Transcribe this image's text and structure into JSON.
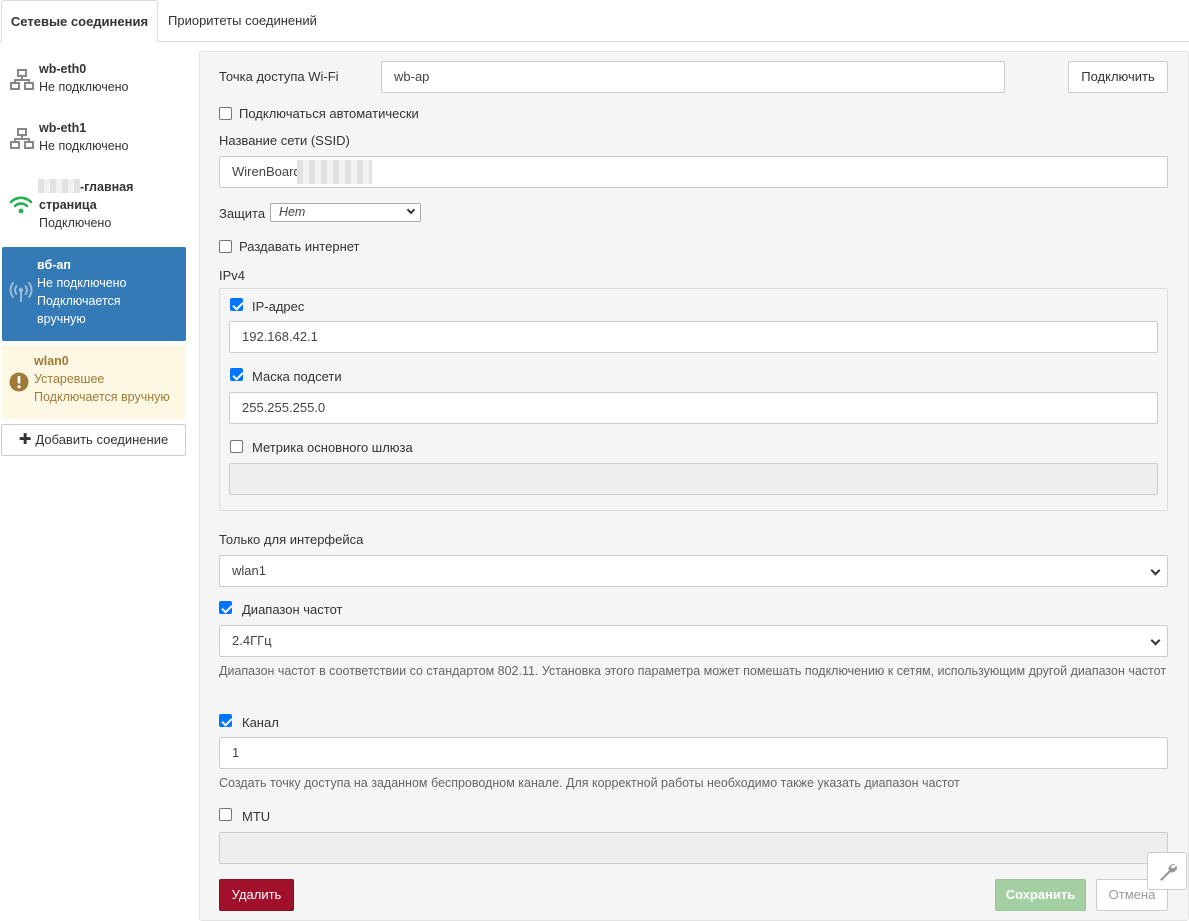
{
  "tabs": [
    "Сетевые соединения",
    "Приоритеты соединений"
  ],
  "connections": [
    {
      "name": "wb-eth0",
      "status": "Не подключено",
      "icon": "ethernet-icon"
    },
    {
      "name": "wb-eth1",
      "status": "Не подключено",
      "icon": "ethernet-icon"
    },
    {
      "name": "-главная",
      "name2": "страница",
      "status": "Подключено",
      "icon": "wifi-icon"
    },
    {
      "name": "вб-ап",
      "status": "Не подключено",
      "status2": "Подключается",
      "status3": "вручную",
      "icon": "access-point-icon"
    },
    {
      "name": "wlan0",
      "status": "Устаревшее",
      "status2": "Подключается вручную",
      "icon": "warning-icon"
    }
  ],
  "add_connection": "Добавить соединение",
  "form": {
    "ap_label": "Точка доступа Wi-Fi",
    "ap_value": "wb-ap",
    "connect_button": "Подключить",
    "auto_connect": "Подключаться автоматически",
    "ssid_label": "Название сети (SSID)",
    "ssid_value": "WirenBoard",
    "security_label": "Защита",
    "security_value": "Нет",
    "share_internet": "Раздавать интернет",
    "ipv4_label": "IPv4",
    "ip_label": "IP-адрес",
    "ip_value": "192.168.42.1",
    "mask_label": "Маска подсети",
    "mask_value": "255.255.255.0",
    "metric_label": "Метрика основного шлюза",
    "iface_label": "Только для интерфейса",
    "iface_value": "wlan1",
    "band_label": "Диапазон частот",
    "band_value": "2.4ГГц",
    "band_help": "Диапазон частот в соответствии со стандартом 802.11. Установка этого параметра может помешать подключению к сетям, использующим другой диапазон частот",
    "channel_label": "Канал",
    "channel_value": "1",
    "channel_help": "Создать точку доступа на заданном беспроводном канале. Для корректной работы необходимо также указать диапазон частот",
    "mtu_label": "MTU",
    "delete_button": "Удалить",
    "save_button": "Сохранить",
    "cancel_button": "Отмена"
  },
  "colors": {
    "primary": "#337ab7",
    "danger": "#a0102a",
    "success": "#a3cfa3",
    "wifi": "#22b14c",
    "warning": "#a07b37"
  }
}
